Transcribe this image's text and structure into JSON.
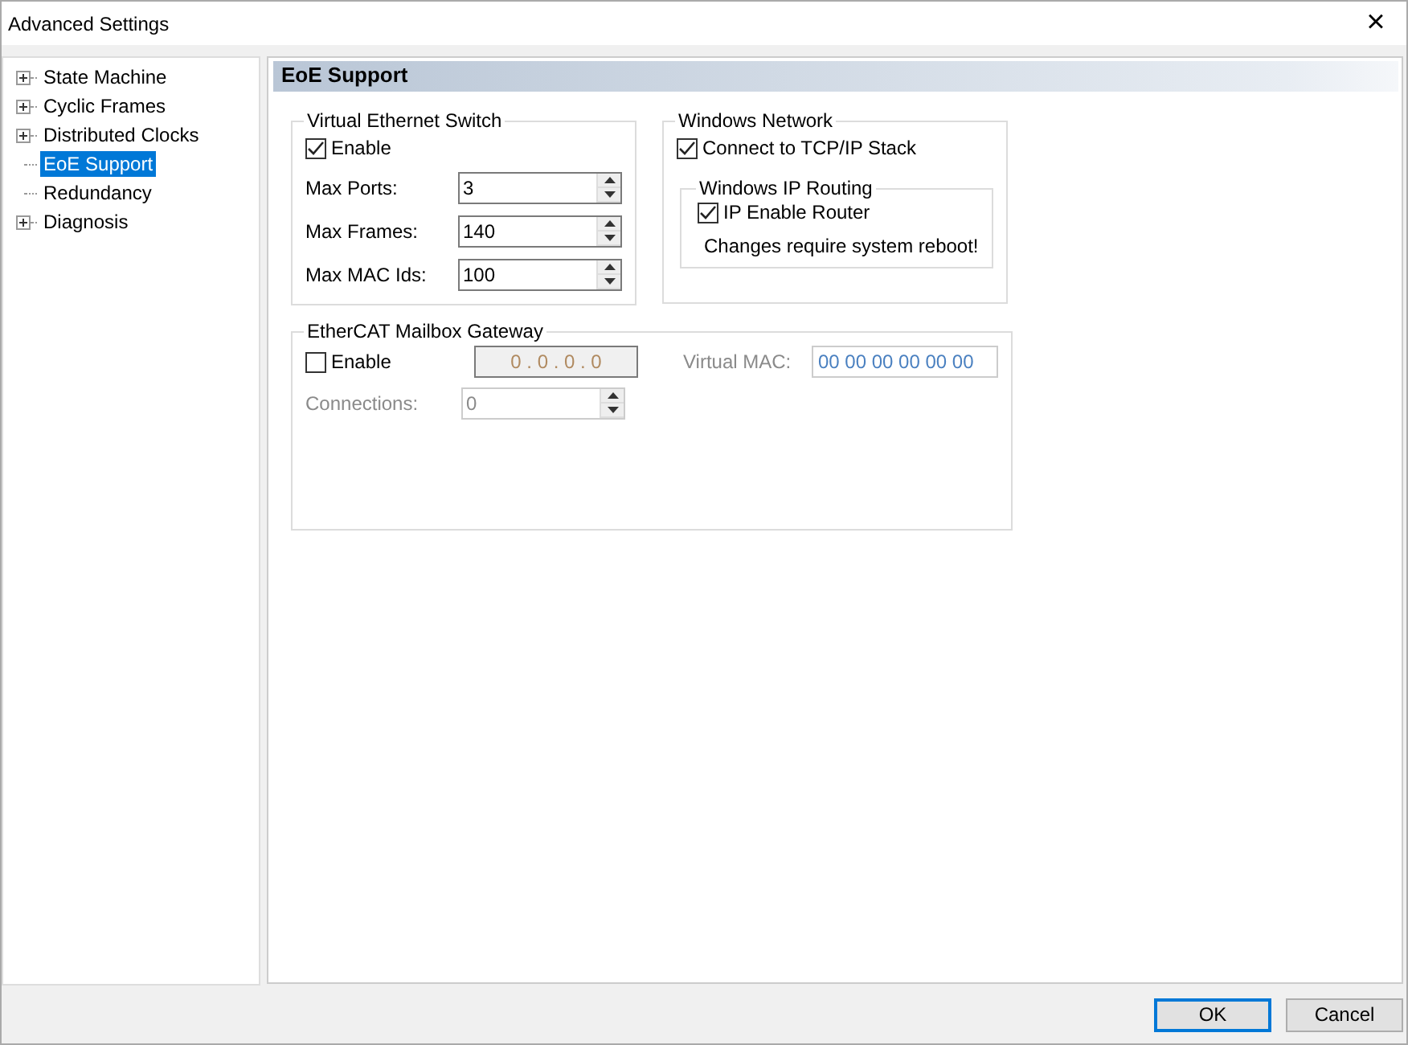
{
  "window": {
    "title": "Advanced Settings",
    "close": "×"
  },
  "tree": [
    {
      "label": "State Machine",
      "kind": "branch",
      "expanded": false,
      "selected": false
    },
    {
      "label": "Cyclic Frames",
      "kind": "branch",
      "expanded": false,
      "selected": false
    },
    {
      "label": "Distributed Clocks",
      "kind": "branch",
      "expanded": false,
      "selected": false
    },
    {
      "label": "EoE Support",
      "kind": "leaf",
      "selected": true
    },
    {
      "label": "Redundancy",
      "kind": "leaf",
      "selected": false
    },
    {
      "label": "Diagnosis",
      "kind": "branch",
      "expanded": false,
      "selected": false
    }
  ],
  "panel_title": "EoE Support",
  "virtual_switch": {
    "title": "Virtual Ethernet Switch",
    "enable": {
      "label": "Enable",
      "checked": true
    },
    "fields": [
      {
        "label": "Max Ports:",
        "value": "3"
      },
      {
        "label": "Max Frames:",
        "value": "140"
      },
      {
        "label": "Max MAC Ids:",
        "value": "100"
      }
    ]
  },
  "windows_network": {
    "title": "Windows Network",
    "connect": {
      "label": "Connect to TCP/IP Stack",
      "checked": true
    },
    "routing": {
      "title": "Windows IP Routing",
      "enable_router": {
        "label": "IP Enable Router",
        "checked": true
      },
      "note": "Changes require system reboot!"
    }
  },
  "mailbox_gateway": {
    "title": "EtherCAT Mailbox Gateway",
    "enable": {
      "label": "Enable",
      "checked": false
    },
    "ip_address": {
      "value": "0 . 0 . 0 . 0",
      "disabled": true
    },
    "virtual_mac": {
      "label": "Virtual MAC:",
      "value": "00 00 00 00 00 00",
      "disabled": true
    },
    "connections": {
      "label": "Connections:",
      "value": "0",
      "disabled": true
    }
  },
  "buttons": [
    {
      "label": "OK",
      "default": true
    },
    {
      "label": "Cancel",
      "default": false
    }
  ]
}
